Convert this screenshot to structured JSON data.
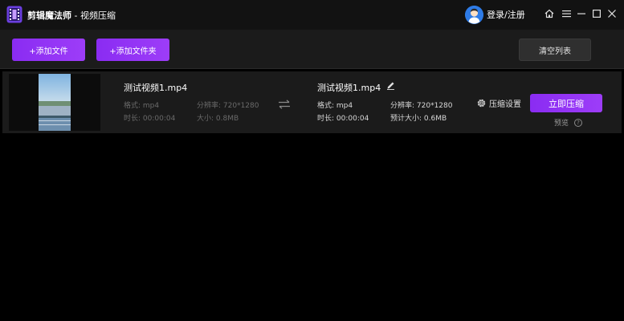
{
  "app": {
    "name": "剪辑魔法师",
    "separator": " - ",
    "module": "视频压缩"
  },
  "header": {
    "login_label": "登录/注册",
    "icons": [
      "home-icon",
      "menu-icon",
      "minimize-icon",
      "maximize-icon",
      "close-icon"
    ]
  },
  "toolbar": {
    "add_file_label": "+添加文件",
    "add_folder_label": "+添加文件夹",
    "clear_list_label": "清空列表"
  },
  "file": {
    "source": {
      "name": "测试视频1.mp4",
      "format": "格式: mp4",
      "duration": "时长: 00:00:04",
      "resolution": "分辨率: 720*1280",
      "size": "大小: 0.8MB"
    },
    "output": {
      "name": "测试视频1.mp4",
      "format": "格式: mp4",
      "duration": "时长: 00:00:04",
      "resolution": "分辨率: 720*1280",
      "estimated_size": "预计大小: 0.6MB"
    },
    "settings_label": "压缩设置",
    "compress_label": "立即压缩",
    "preview_label": "预览",
    "help_glyph": "?"
  },
  "colors": {
    "accent": "#9333f5",
    "titlebar": "#121212",
    "panel": "#1b1b1b",
    "background": "#000000"
  }
}
